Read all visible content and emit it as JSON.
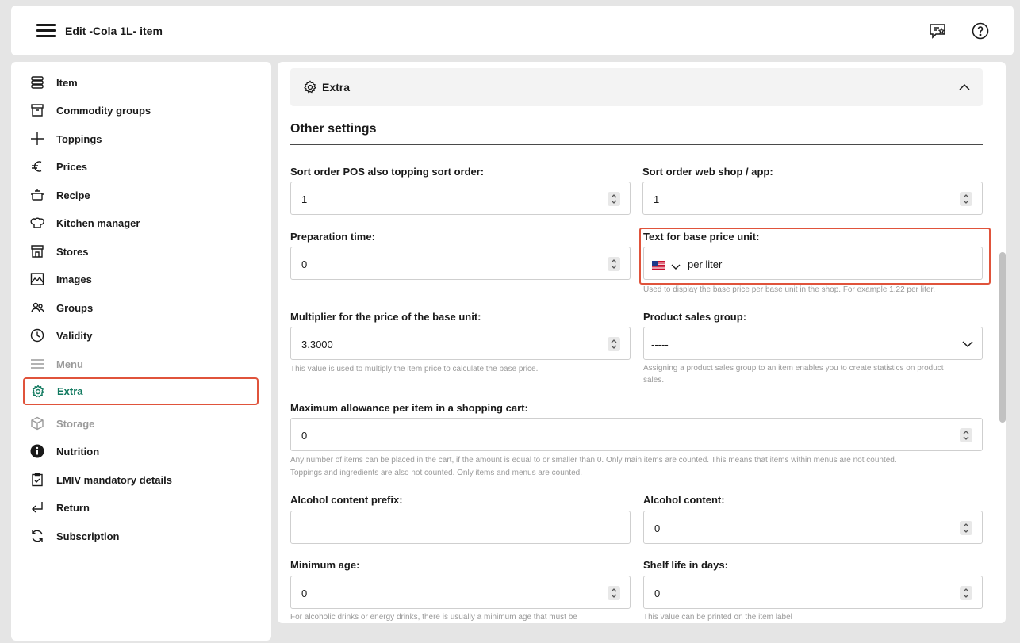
{
  "header": {
    "title": "Edit -Cola 1L- item"
  },
  "sidebar": {
    "items": [
      {
        "label": "Item",
        "icon": "database-icon"
      },
      {
        "label": "Commodity groups",
        "icon": "archive-box-icon"
      },
      {
        "label": "Toppings",
        "icon": "plus-icon"
      },
      {
        "label": "Prices",
        "icon": "euro-icon"
      },
      {
        "label": "Recipe",
        "icon": "cooking-pot-icon"
      },
      {
        "label": "Kitchen manager",
        "icon": "chef-hat-icon"
      },
      {
        "label": "Stores",
        "icon": "store-icon"
      },
      {
        "label": "Images",
        "icon": "image-icon"
      },
      {
        "label": "Groups",
        "icon": "users-icon"
      },
      {
        "label": "Validity",
        "icon": "clock-icon"
      },
      {
        "label": "Menu",
        "icon": "menu-lines-icon"
      },
      {
        "label": "Extra",
        "icon": "gear-icon"
      },
      {
        "label": "Storage",
        "icon": "box-icon"
      },
      {
        "label": "Nutrition",
        "icon": "info-icon"
      },
      {
        "label": "LMIV mandatory details",
        "icon": "clipboard-check-icon"
      },
      {
        "label": "Return",
        "icon": "return-arrow-icon"
      },
      {
        "label": "Subscription",
        "icon": "refresh-icon"
      }
    ]
  },
  "main": {
    "section_title": "Extra",
    "subsection_title": "Other settings",
    "fields": {
      "sort_pos": {
        "label": "Sort order POS also topping sort order:",
        "value": "1"
      },
      "sort_web": {
        "label": "Sort order web shop / app:",
        "value": "1"
      },
      "prep_time": {
        "label": "Preparation time:",
        "value": "0"
      },
      "base_unit_text": {
        "label": "Text for base price unit:",
        "value": "per liter",
        "hint": "Used to display the base price per base unit in the shop. For example 1.22 per liter."
      },
      "multiplier": {
        "label": "Multiplier for the price of the base unit:",
        "value": "3.3000",
        "hint": "This value is used to multiply the item price to calculate the base price."
      },
      "sales_group": {
        "label": "Product sales group:",
        "value": "-----",
        "hint_1": "Assigning a product sales group to an item enables you to create statistics on product",
        "hint_2": "sales."
      },
      "max_allowance": {
        "label": "Maximum allowance per item in a shopping cart:",
        "value": "0",
        "hint_1": "Any number of items can be placed in the cart, if the amount is equal to or smaller than 0. Only main items are counted. This means that items within menus are not counted.",
        "hint_2": "Toppings and ingredients are also not counted. Only items and menus are counted."
      },
      "alcohol_prefix": {
        "label": "Alcohol content prefix:",
        "value": ""
      },
      "alcohol_content": {
        "label": "Alcohol content:",
        "value": "0"
      },
      "min_age": {
        "label": "Minimum age:",
        "value": "0",
        "hint": "For alcoholic drinks or energy drinks, there is usually a minimum age that must be"
      },
      "shelf_life": {
        "label": "Shelf life in days:",
        "value": "0",
        "hint": "This value can be printed on the item label"
      }
    }
  },
  "colors": {
    "accent_green": "#127a60",
    "highlight_red": "#e0533b"
  }
}
